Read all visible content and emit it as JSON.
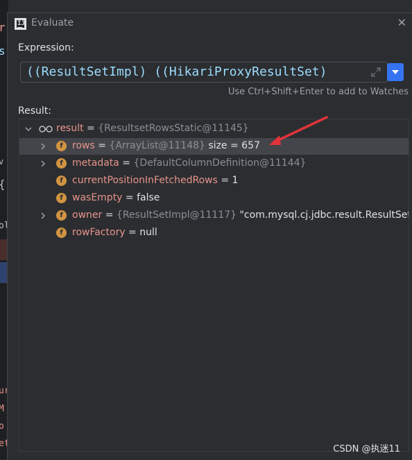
{
  "editor": {
    "glyphs": [
      "r",
      "s",
      "v",
      "{",
      "ol",
      "ur",
      "M",
      "o",
      "et"
    ]
  },
  "dialog": {
    "title": "Evaluate",
    "close_glyph": "✕",
    "expression_label": "Expression:",
    "expression_value": "((ResultSetImpl) ((HikariProxyResultSet)",
    "hint": "Use Ctrl+Shift+Enter to add to Watches",
    "result_label": "Result:"
  },
  "tree": {
    "root": {
      "name": "result",
      "eq": " = ",
      "ref": "{ResultsetRowsStatic@11145}"
    },
    "items": [
      {
        "name": "rows",
        "eq": " = ",
        "ref": "{ArrayList@11148}",
        "value": "  size = 657",
        "expandable": true,
        "selected": true
      },
      {
        "name": "metadata",
        "eq": " = ",
        "ref": "{DefaultColumnDefinition@11144}",
        "value": "",
        "expandable": true,
        "selected": false
      },
      {
        "name": "currentPositionInFetchedRows",
        "eq": " = ",
        "ref": "",
        "value": "1",
        "expandable": false,
        "selected": false
      },
      {
        "name": "wasEmpty",
        "eq": " = ",
        "ref": "",
        "value": "false",
        "expandable": false,
        "selected": false
      },
      {
        "name": "owner",
        "eq": " = ",
        "ref": "{ResultSetImpl@11117}",
        "value": " \"com.mysql.cj.jdbc.result.ResultSetImpl@",
        "expandable": true,
        "selected": false
      },
      {
        "name": "rowFactory",
        "eq": " = ",
        "ref": "",
        "value": "null",
        "expandable": false,
        "selected": false
      }
    ],
    "field_icon_letter": "f"
  },
  "watermark": "CSDN @执迷11",
  "colors": {
    "background": "#2b2d30",
    "accent": "#3574f0",
    "field_icon": "#d19441",
    "field_name": "#e8948c",
    "annotation_arrow": "#e0333a"
  }
}
